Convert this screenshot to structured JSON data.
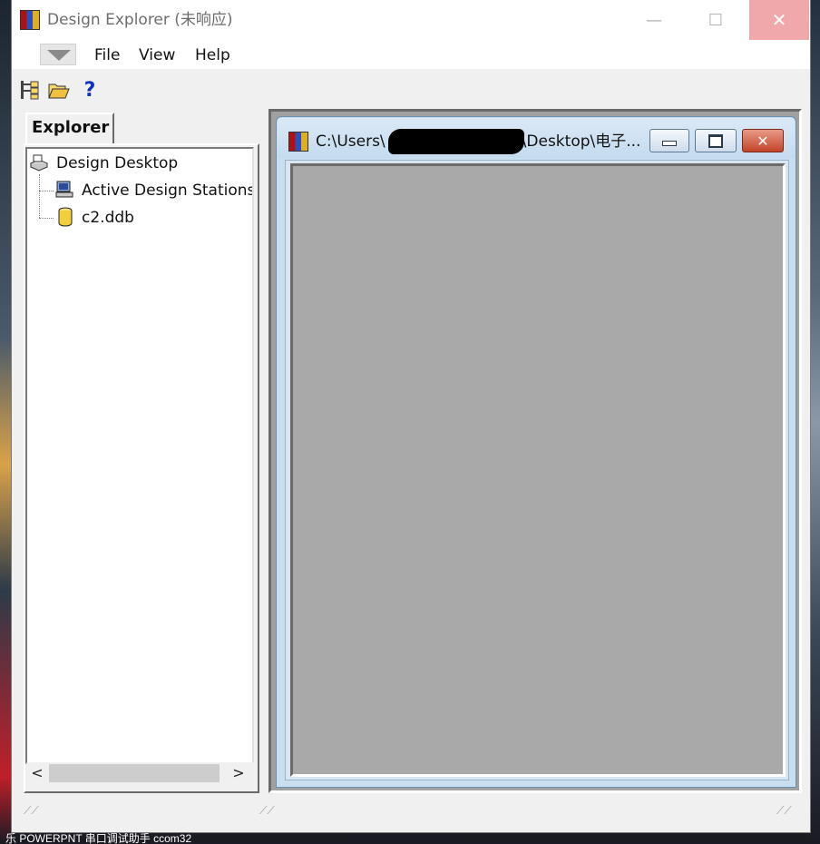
{
  "window": {
    "title": "Design Explorer (未响应)",
    "minimize_glyph": "—",
    "maximize_glyph": "☐",
    "close_glyph": "✕"
  },
  "menu": {
    "items": [
      {
        "label": "File"
      },
      {
        "label": "View"
      },
      {
        "label": "Help"
      }
    ]
  },
  "toolbar": {
    "buttons": [
      {
        "icon": "tree-view-icon"
      },
      {
        "icon": "open-folder-icon"
      },
      {
        "icon": "help-icon",
        "glyph": "?"
      }
    ]
  },
  "explorer": {
    "tab_label": "Explorer",
    "tree": [
      {
        "label": "Design Desktop",
        "icon": "desktop-icon"
      },
      {
        "label": "Active Design Stations",
        "icon": "workstation-icon"
      },
      {
        "label": "c2.ddb",
        "icon": "database-icon"
      }
    ],
    "scroll_left": "<",
    "scroll_right": ">"
  },
  "child_window": {
    "title_prefix": "C:\\Users\\",
    "title_suffix": "\\Desktop\\电子..."
  },
  "taskbar": {
    "text": "乐   POWERPNT   串口调试助手   ccom32"
  },
  "colors": {
    "close_hover": "#f1a8ab",
    "workspace": "#a9a9a9",
    "child_title": "#c4dbef"
  }
}
